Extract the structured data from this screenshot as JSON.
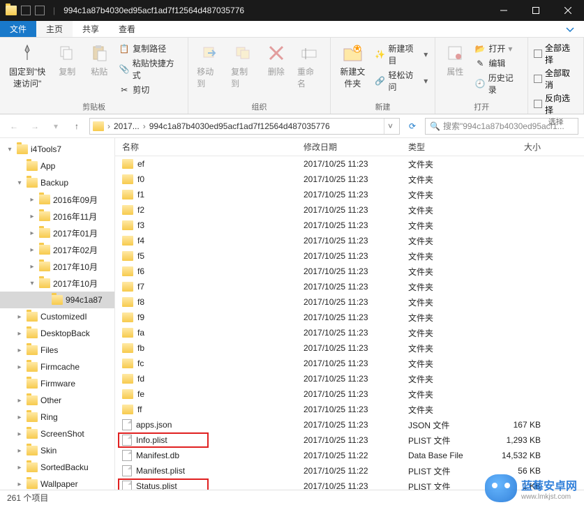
{
  "window": {
    "title": "994c1a87b4030ed95acf1ad7f12564d487035776"
  },
  "tabs": {
    "file": "文件",
    "home": "主页",
    "share": "共享",
    "view": "查看"
  },
  "ribbon": {
    "pin": "固定到\"快速访问\"",
    "copy": "复制",
    "paste": "粘贴",
    "copy_path": "复制路径",
    "paste_shortcut": "粘贴快捷方式",
    "cut": "剪切",
    "clipboard_label": "剪贴板",
    "move_to": "移动到",
    "copy_to": "复制到",
    "delete": "删除",
    "rename": "重命名",
    "organize_label": "组织",
    "new_folder": "新建文件夹",
    "new_item": "新建项目",
    "easy_access": "轻松访问",
    "new_label": "新建",
    "properties": "属性",
    "open": "打开",
    "edit": "编辑",
    "history": "历史记录",
    "open_label": "打开",
    "select_all": "全部选择",
    "select_none": "全部取消",
    "invert": "反向选择",
    "select_label": "选择"
  },
  "breadcrumb": {
    "first": "2017...",
    "second": "994c1a87b4030ed95acf1ad7f12564d487035776"
  },
  "search_placeholder": "搜索\"994c1a87b4030ed95acf1...",
  "tree": [
    {
      "label": "i4Tools7",
      "indent": 0,
      "twisty": "▾",
      "selected": false
    },
    {
      "label": "App",
      "indent": 1,
      "twisty": "",
      "selected": false
    },
    {
      "label": "Backup",
      "indent": 1,
      "twisty": "▾",
      "selected": false
    },
    {
      "label": "2016年09月",
      "indent": 2,
      "twisty": "▸",
      "selected": false
    },
    {
      "label": "2016年11月",
      "indent": 2,
      "twisty": "▸",
      "selected": false
    },
    {
      "label": "2017年01月",
      "indent": 2,
      "twisty": "▸",
      "selected": false
    },
    {
      "label": "2017年02月",
      "indent": 2,
      "twisty": "▸",
      "selected": false
    },
    {
      "label": "2017年10月",
      "indent": 2,
      "twisty": "▸",
      "selected": false
    },
    {
      "label": "2017年10月",
      "indent": 2,
      "twisty": "▾",
      "selected": false
    },
    {
      "label": "994c1a87",
      "indent": 3,
      "twisty": "",
      "selected": true
    },
    {
      "label": "CustomizedI",
      "indent": 1,
      "twisty": "▸",
      "selected": false
    },
    {
      "label": "DesktopBack",
      "indent": 1,
      "twisty": "▸",
      "selected": false
    },
    {
      "label": "Files",
      "indent": 1,
      "twisty": "▸",
      "selected": false
    },
    {
      "label": "Firmcache",
      "indent": 1,
      "twisty": "▸",
      "selected": false
    },
    {
      "label": "Firmware",
      "indent": 1,
      "twisty": "",
      "selected": false
    },
    {
      "label": "Other",
      "indent": 1,
      "twisty": "▸",
      "selected": false
    },
    {
      "label": "Ring",
      "indent": 1,
      "twisty": "▸",
      "selected": false
    },
    {
      "label": "ScreenShot",
      "indent": 1,
      "twisty": "▸",
      "selected": false
    },
    {
      "label": "Skin",
      "indent": 1,
      "twisty": "▸",
      "selected": false
    },
    {
      "label": "SortedBacku",
      "indent": 1,
      "twisty": "▸",
      "selected": false
    },
    {
      "label": "Wallpaper",
      "indent": 1,
      "twisty": "▸",
      "selected": false
    }
  ],
  "columns": {
    "name": "名称",
    "date": "修改日期",
    "type": "类型",
    "size": "大小"
  },
  "rows": [
    {
      "name": "ef",
      "date": "2017/10/25 11:23",
      "type": "文件夹",
      "size": "",
      "kind": "folder"
    },
    {
      "name": "f0",
      "date": "2017/10/25 11:23",
      "type": "文件夹",
      "size": "",
      "kind": "folder"
    },
    {
      "name": "f1",
      "date": "2017/10/25 11:23",
      "type": "文件夹",
      "size": "",
      "kind": "folder"
    },
    {
      "name": "f2",
      "date": "2017/10/25 11:23",
      "type": "文件夹",
      "size": "",
      "kind": "folder"
    },
    {
      "name": "f3",
      "date": "2017/10/25 11:23",
      "type": "文件夹",
      "size": "",
      "kind": "folder"
    },
    {
      "name": "f4",
      "date": "2017/10/25 11:23",
      "type": "文件夹",
      "size": "",
      "kind": "folder"
    },
    {
      "name": "f5",
      "date": "2017/10/25 11:23",
      "type": "文件夹",
      "size": "",
      "kind": "folder"
    },
    {
      "name": "f6",
      "date": "2017/10/25 11:23",
      "type": "文件夹",
      "size": "",
      "kind": "folder"
    },
    {
      "name": "f7",
      "date": "2017/10/25 11:23",
      "type": "文件夹",
      "size": "",
      "kind": "folder"
    },
    {
      "name": "f8",
      "date": "2017/10/25 11:23",
      "type": "文件夹",
      "size": "",
      "kind": "folder"
    },
    {
      "name": "f9",
      "date": "2017/10/25 11:23",
      "type": "文件夹",
      "size": "",
      "kind": "folder"
    },
    {
      "name": "fa",
      "date": "2017/10/25 11:23",
      "type": "文件夹",
      "size": "",
      "kind": "folder"
    },
    {
      "name": "fb",
      "date": "2017/10/25 11:23",
      "type": "文件夹",
      "size": "",
      "kind": "folder"
    },
    {
      "name": "fc",
      "date": "2017/10/25 11:23",
      "type": "文件夹",
      "size": "",
      "kind": "folder"
    },
    {
      "name": "fd",
      "date": "2017/10/25 11:23",
      "type": "文件夹",
      "size": "",
      "kind": "folder"
    },
    {
      "name": "fe",
      "date": "2017/10/25 11:23",
      "type": "文件夹",
      "size": "",
      "kind": "folder"
    },
    {
      "name": "ff",
      "date": "2017/10/25 11:23",
      "type": "文件夹",
      "size": "",
      "kind": "folder"
    },
    {
      "name": "apps.json",
      "date": "2017/10/25 11:23",
      "type": "JSON 文件",
      "size": "167 KB",
      "kind": "file"
    },
    {
      "name": "Info.plist",
      "date": "2017/10/25 11:23",
      "type": "PLIST 文件",
      "size": "1,293 KB",
      "kind": "file",
      "hl": true
    },
    {
      "name": "Manifest.db",
      "date": "2017/10/25 11:22",
      "type": "Data Base File",
      "size": "14,532 KB",
      "kind": "file"
    },
    {
      "name": "Manifest.plist",
      "date": "2017/10/25 11:22",
      "type": "PLIST 文件",
      "size": "56 KB",
      "kind": "file"
    },
    {
      "name": "Status.plist",
      "date": "2017/10/25 11:23",
      "type": "PLIST 文件",
      "size": "1 KB",
      "kind": "file",
      "hl": true
    }
  ],
  "status": "261 个项目",
  "watermark": {
    "l1": "蓝莓安卓网",
    "l2": "www.lmkjst.com"
  }
}
